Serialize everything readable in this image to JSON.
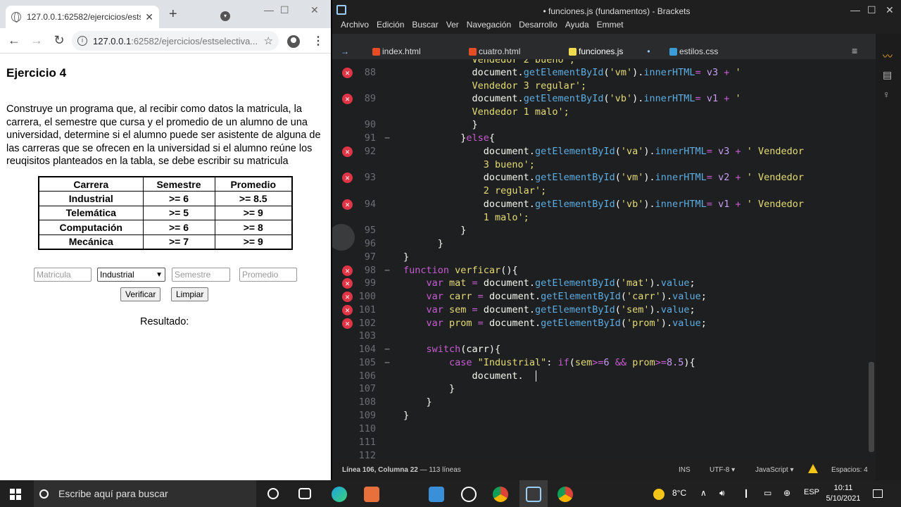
{
  "chrome": {
    "tab_title": "127.0.0.1:62582/ejercicios/estse",
    "url_host": "127.0.0.1",
    "url_rest": ":62582/ejercicios/estselectiva..."
  },
  "page": {
    "heading": "Ejercicio 4",
    "description": "Construye un programa que, al recibir como datos la matricula, la carrera, el semestre que cursa y el promedio de un alumno de una universidad, determine si el alumno puede ser asistente de alguna de las carreras que se ofrecen en la universidad si el alumno reúne los reuqisitos planteados en la tabla, se debe escribir su matricula",
    "table": {
      "headers": [
        "Carrera",
        "Semestre",
        "Promedio"
      ],
      "rows": [
        [
          "Industrial",
          ">= 6",
          ">= 8.5"
        ],
        [
          "Telemática",
          ">= 5",
          ">= 9"
        ],
        [
          "Computación",
          ">= 6",
          ">= 8"
        ],
        [
          "Mecánica",
          ">= 7",
          ">= 9"
        ]
      ]
    },
    "form": {
      "matricula_placeholder": "Matricula",
      "carrera_selected": "Industrial",
      "semestre_placeholder": "Semestre",
      "promedio_placeholder": "Promedio",
      "verificar_label": "Verificar",
      "limpiar_label": "Limpiar"
    },
    "result_label": "Resultado:"
  },
  "brackets": {
    "title": "• funciones.js (fundamentos) - Brackets",
    "menu": [
      "Archivo",
      "Edición",
      "Buscar",
      "Ver",
      "Navegación",
      "Desarrollo",
      "Ayuda",
      "Emmet"
    ],
    "tabs": [
      {
        "name": "index.html",
        "color": "#e44d26"
      },
      {
        "name": "cuatro.html",
        "color": "#e44d26"
      },
      {
        "name": "funciones.js",
        "color": "#f0db4f"
      },
      {
        "name": "estilos.css",
        "color": "#3c9cd7"
      }
    ],
    "status": {
      "position": "Línea 106, Columna 22",
      "lines": "— 113 líneas",
      "mode": "INS",
      "encoding": "UTF-8",
      "language": "JavaScript",
      "spaces": "Espacios: 4"
    }
  },
  "taskbar": {
    "search_placeholder": "Escribe aquí para buscar",
    "weather": "8°C",
    "lang": "ESP",
    "time": "10:11",
    "date": "5/10/2021"
  }
}
